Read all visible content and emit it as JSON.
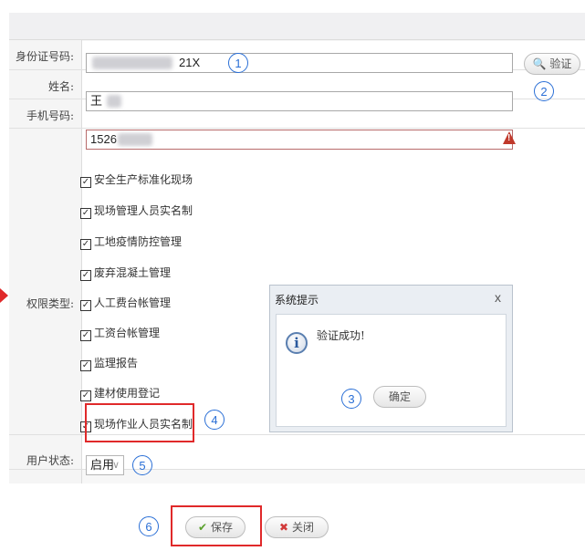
{
  "form": {
    "id_label": "身份证号码:",
    "id_value_suffix": "21X",
    "verify_label": "验证",
    "name_label": "姓名:",
    "name_value": "王",
    "phone_label": "手机号码:",
    "phone_value": "1526",
    "permission_label": "权限类型:",
    "permissions": [
      "安全生产标准化现场",
      "现场管理人员实名制",
      "工地疫情防控管理",
      "废弃混凝土管理",
      "人工费台帐管理",
      "工资台帐管理",
      "监理报告",
      "建材使用登记",
      "现场作业人员实名制"
    ],
    "status_label": "用户状态:",
    "status_value": "启用",
    "save_label": "保存",
    "close_label": "关闭"
  },
  "dialog": {
    "title": "系统提示",
    "close_glyph": "x",
    "message": "验证成功!",
    "ok_label": "确定"
  },
  "markers": [
    "1",
    "2",
    "3",
    "4",
    "5",
    "6"
  ],
  "colors": {
    "marker_blue": "#2a6fd6",
    "highlight_red": "#e0292a",
    "error_border": "#b86b6b"
  }
}
